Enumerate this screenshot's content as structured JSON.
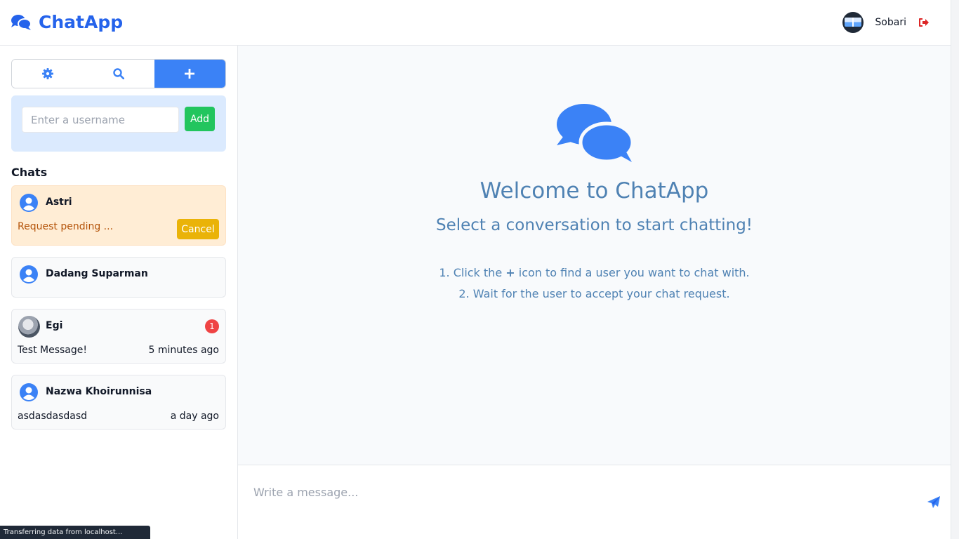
{
  "header": {
    "app_name": "ChatApp",
    "user_name": "Sobari",
    "brand_icon": "comments-icon",
    "logout_icon": "sign-out-icon",
    "brand_color": "#2563eb"
  },
  "sidebar": {
    "tabs": [
      {
        "icon": "gear-icon",
        "active": false
      },
      {
        "icon": "search-icon",
        "active": false
      },
      {
        "icon": "plus-icon",
        "active": true
      }
    ],
    "add_user": {
      "placeholder": "Enter a username",
      "button_label": "Add"
    },
    "chats_title": "Chats",
    "chats": [
      {
        "name": "Astri",
        "status_text": "Request pending ...",
        "action_label": "Cancel"
      },
      {
        "name": "Dadang Suparman"
      },
      {
        "name": "Egi",
        "last_message": "Test Message!",
        "time": "5 minutes ago",
        "unread": "1"
      },
      {
        "name": "Nazwa Khoirunnisa",
        "last_message": "asdasdasdasd",
        "time": "a day ago"
      }
    ]
  },
  "main": {
    "title": "Welcome to ChatApp",
    "subtitle": "Select a conversation to start chatting!",
    "step1_pre": "1. Click the ",
    "step1_icon": "+",
    "step1_post": " icon to find a user you want to chat with.",
    "step2": "2. Wait for the user to accept your chat request."
  },
  "composer": {
    "placeholder": "Write a message...",
    "send_icon": "paper-plane-icon"
  },
  "status_bar": "Transferring data from localhost..."
}
